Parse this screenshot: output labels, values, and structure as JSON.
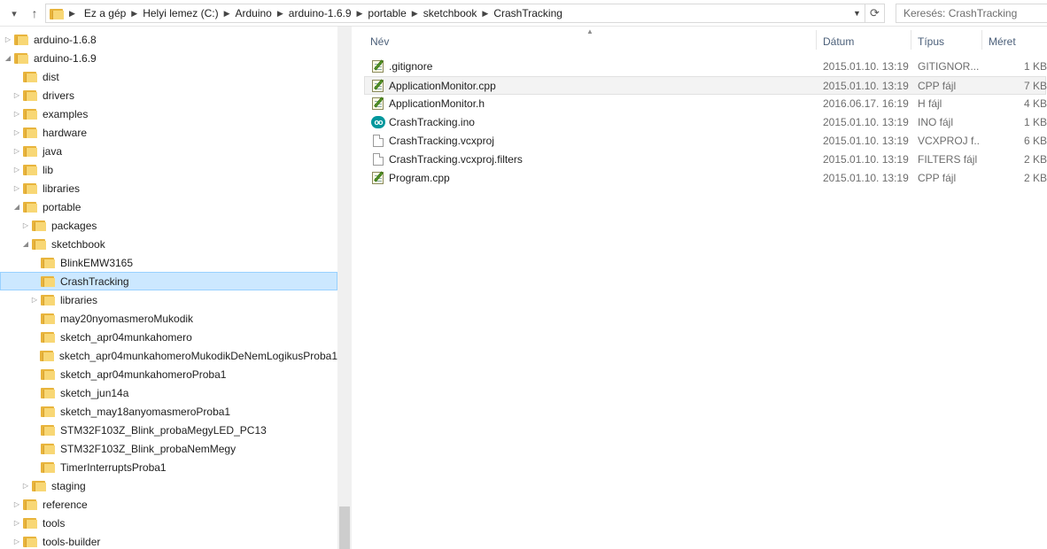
{
  "address_bar": {
    "breadcrumbs": [
      "Ez a gép",
      "Helyi lemez (C:)",
      "Arduino",
      "arduino-1.6.9",
      "portable",
      "sketchbook",
      "CrashTracking"
    ],
    "search_placeholder": "Keresés: CrashTracking"
  },
  "tree": {
    "items": [
      {
        "label": "arduino-1.6.8",
        "level": 0,
        "expander": "collapsed"
      },
      {
        "label": "arduino-1.6.9",
        "level": 0,
        "expander": "expanded"
      },
      {
        "label": "dist",
        "level": 1,
        "expander": "none"
      },
      {
        "label": "drivers",
        "level": 1,
        "expander": "collapsed"
      },
      {
        "label": "examples",
        "level": 1,
        "expander": "collapsed"
      },
      {
        "label": "hardware",
        "level": 1,
        "expander": "collapsed"
      },
      {
        "label": "java",
        "level": 1,
        "expander": "collapsed"
      },
      {
        "label": "lib",
        "level": 1,
        "expander": "collapsed"
      },
      {
        "label": "libraries",
        "level": 1,
        "expander": "collapsed"
      },
      {
        "label": "portable",
        "level": 1,
        "expander": "expanded"
      },
      {
        "label": "packages",
        "level": 2,
        "expander": "collapsed"
      },
      {
        "label": "sketchbook",
        "level": 2,
        "expander": "expanded"
      },
      {
        "label": "BlinkEMW3165",
        "level": 3,
        "expander": "none"
      },
      {
        "label": "CrashTracking",
        "level": 3,
        "expander": "none",
        "selected": true
      },
      {
        "label": "libraries",
        "level": 3,
        "expander": "collapsed"
      },
      {
        "label": "may20nyomasmeroMukodik",
        "level": 3,
        "expander": "none"
      },
      {
        "label": "sketch_apr04munkahomero",
        "level": 3,
        "expander": "none"
      },
      {
        "label": "sketch_apr04munkahomeroMukodikDeNemLogikusProba1",
        "level": 3,
        "expander": "none"
      },
      {
        "label": "sketch_apr04munkahomeroProba1",
        "level": 3,
        "expander": "none"
      },
      {
        "label": "sketch_jun14a",
        "level": 3,
        "expander": "none"
      },
      {
        "label": "sketch_may18anyomasmeroProba1",
        "level": 3,
        "expander": "none"
      },
      {
        "label": "STM32F103Z_Blink_probaMegyLED_PC13",
        "level": 3,
        "expander": "none"
      },
      {
        "label": "STM32F103Z_Blink_probaNemMegy",
        "level": 3,
        "expander": "none"
      },
      {
        "label": "TimerInterruptsProba1",
        "level": 3,
        "expander": "none"
      },
      {
        "label": "staging",
        "level": 2,
        "expander": "collapsed"
      },
      {
        "label": "reference",
        "level": 1,
        "expander": "collapsed"
      },
      {
        "label": "tools",
        "level": 1,
        "expander": "collapsed"
      },
      {
        "label": "tools-builder",
        "level": 1,
        "expander": "collapsed"
      }
    ]
  },
  "file_list": {
    "columns": {
      "name": "Név",
      "date": "Dátum",
      "type": "Típus",
      "size": "Méret"
    },
    "files": [
      {
        "name": ".gitignore",
        "date": "2015.01.10. 13:19",
        "type": "GITIGNOR...",
        "size": "1 KB",
        "icon": "notepad-icon"
      },
      {
        "name": "ApplicationMonitor.cpp",
        "date": "2015.01.10. 13:19",
        "type": "CPP fájl",
        "size": "7 KB",
        "icon": "notepad-icon",
        "hover": true
      },
      {
        "name": "ApplicationMonitor.h",
        "date": "2016.06.17. 16:19",
        "type": "H fájl",
        "size": "4 KB",
        "icon": "notepad-icon"
      },
      {
        "name": "CrashTracking.ino",
        "date": "2015.01.10. 13:19",
        "type": "INO fájl",
        "size": "1 KB",
        "icon": "arduino-icon"
      },
      {
        "name": "CrashTracking.vcxproj",
        "date": "2015.01.10. 13:19",
        "type": "VCXPROJ f...",
        "size": "6 KB",
        "icon": "blank-file-icon"
      },
      {
        "name": "CrashTracking.vcxproj.filters",
        "date": "2015.01.10. 13:19",
        "type": "FILTERS fájl",
        "size": "2 KB",
        "icon": "blank-file-icon"
      },
      {
        "name": "Program.cpp",
        "date": "2015.01.10. 13:19",
        "type": "CPP fájl",
        "size": "2 KB",
        "icon": "notepad-icon"
      }
    ]
  }
}
